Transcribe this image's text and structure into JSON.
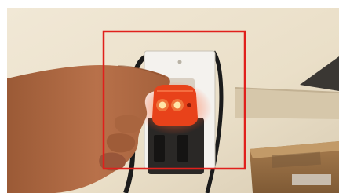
{
  "image": {
    "kind": "photo",
    "description_terms": [
      "hand",
      "wall-outlet",
      "outlet-tester",
      "red-highlight-box",
      "cardboard-box"
    ],
    "highlight_color": "#e0201c",
    "tester_color": "#e8421a",
    "indicator_light_color": "#fff1c2"
  }
}
